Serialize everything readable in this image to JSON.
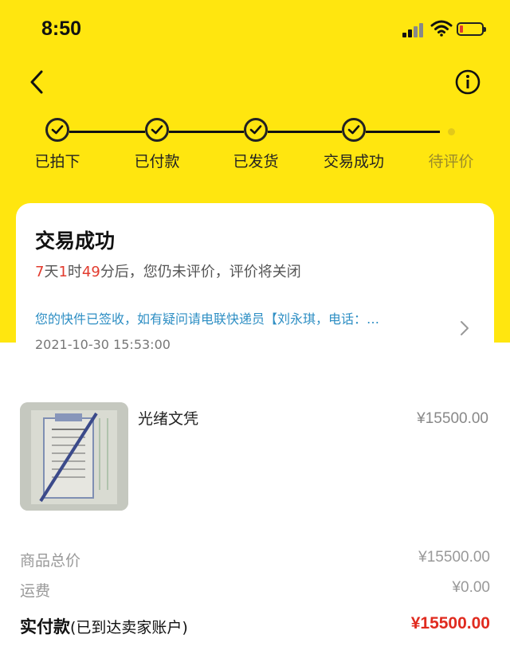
{
  "status_bar": {
    "time": "8:50"
  },
  "steps": [
    {
      "label": "已拍下",
      "done": true
    },
    {
      "label": "已付款",
      "done": true
    },
    {
      "label": "已发货",
      "done": true
    },
    {
      "label": "交易成功",
      "done": true
    },
    {
      "label": "待评价",
      "done": false
    }
  ],
  "status_card": {
    "title": "交易成功",
    "countdown": {
      "days": "7",
      "days_unit": "天",
      "hours": "1",
      "hours_unit": "时",
      "minutes": "49",
      "minutes_suffix": "分后，您仍未评价，评价将关闭"
    },
    "logistics_notice": "您的快件已签收，如有疑问请电联快递员【刘永琪，电话：…",
    "logistics_time": "2021-10-30 15:53:00"
  },
  "item": {
    "name": "光绪文凭",
    "price": "¥15500.00"
  },
  "summary": {
    "goods_total_label": "商品总价",
    "goods_total_value": "¥15500.00",
    "shipping_label": "运费",
    "shipping_value": "¥0.00",
    "paid_label": "实付款",
    "paid_note": "(已到达卖家账户)",
    "paid_value": "¥15500.00"
  },
  "colors": {
    "brand_yellow": "#FFE60F",
    "price_red": "#e02b1f",
    "link_blue": "#2f8fc4"
  }
}
